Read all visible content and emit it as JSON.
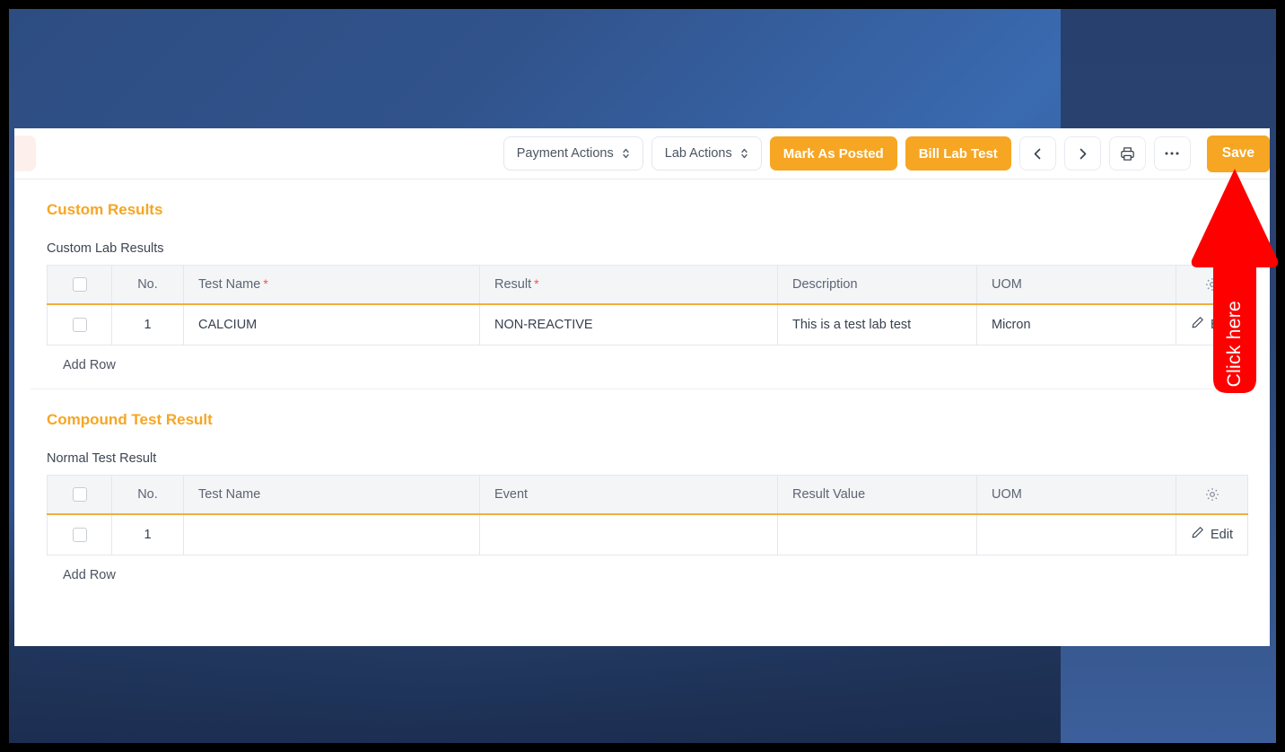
{
  "theme": {
    "accent": "#f6a623",
    "annotation": "#ff0000",
    "required_mark": "#f0544c",
    "header_bg": "#f4f5f7",
    "desktop_blue": "#31538c"
  },
  "toolbar": {
    "payment_actions": "Payment Actions",
    "lab_actions": "Lab Actions",
    "mark_as_posted": "Mark As Posted",
    "bill_lab_test": "Bill Lab Test",
    "prev_label": "chevron-left-icon",
    "next_label": "chevron-right-icon",
    "print_label": "printer-icon",
    "more_label": "ellipsis-icon",
    "save": "Save"
  },
  "sections": [
    {
      "title": "Custom Results",
      "field_label": "Custom Lab Results",
      "columns": [
        "",
        "No.",
        "Test Name",
        "Result",
        "Description",
        "UOM",
        ""
      ],
      "required_columns": [
        "Test Name",
        "Result"
      ],
      "rows": [
        {
          "no": "1",
          "test_name": "CALCIUM",
          "result": "NON-REACTIVE",
          "description": "This is a test lab test",
          "uom": "Micron",
          "edit": "Edit"
        }
      ],
      "add_row": "Add Row"
    },
    {
      "title": "Compound Test Result",
      "field_label": "Normal Test Result",
      "columns": [
        "",
        "No.",
        "Test Name",
        "Event",
        "Result Value",
        "UOM",
        ""
      ],
      "required_columns": [],
      "rows": [
        {
          "no": "1",
          "test_name": "",
          "result": "",
          "description": "",
          "uom": "",
          "edit": "Edit"
        }
      ],
      "add_row": "Add Row"
    }
  ],
  "annotation": {
    "text": "Click here",
    "points_to": "Save"
  }
}
